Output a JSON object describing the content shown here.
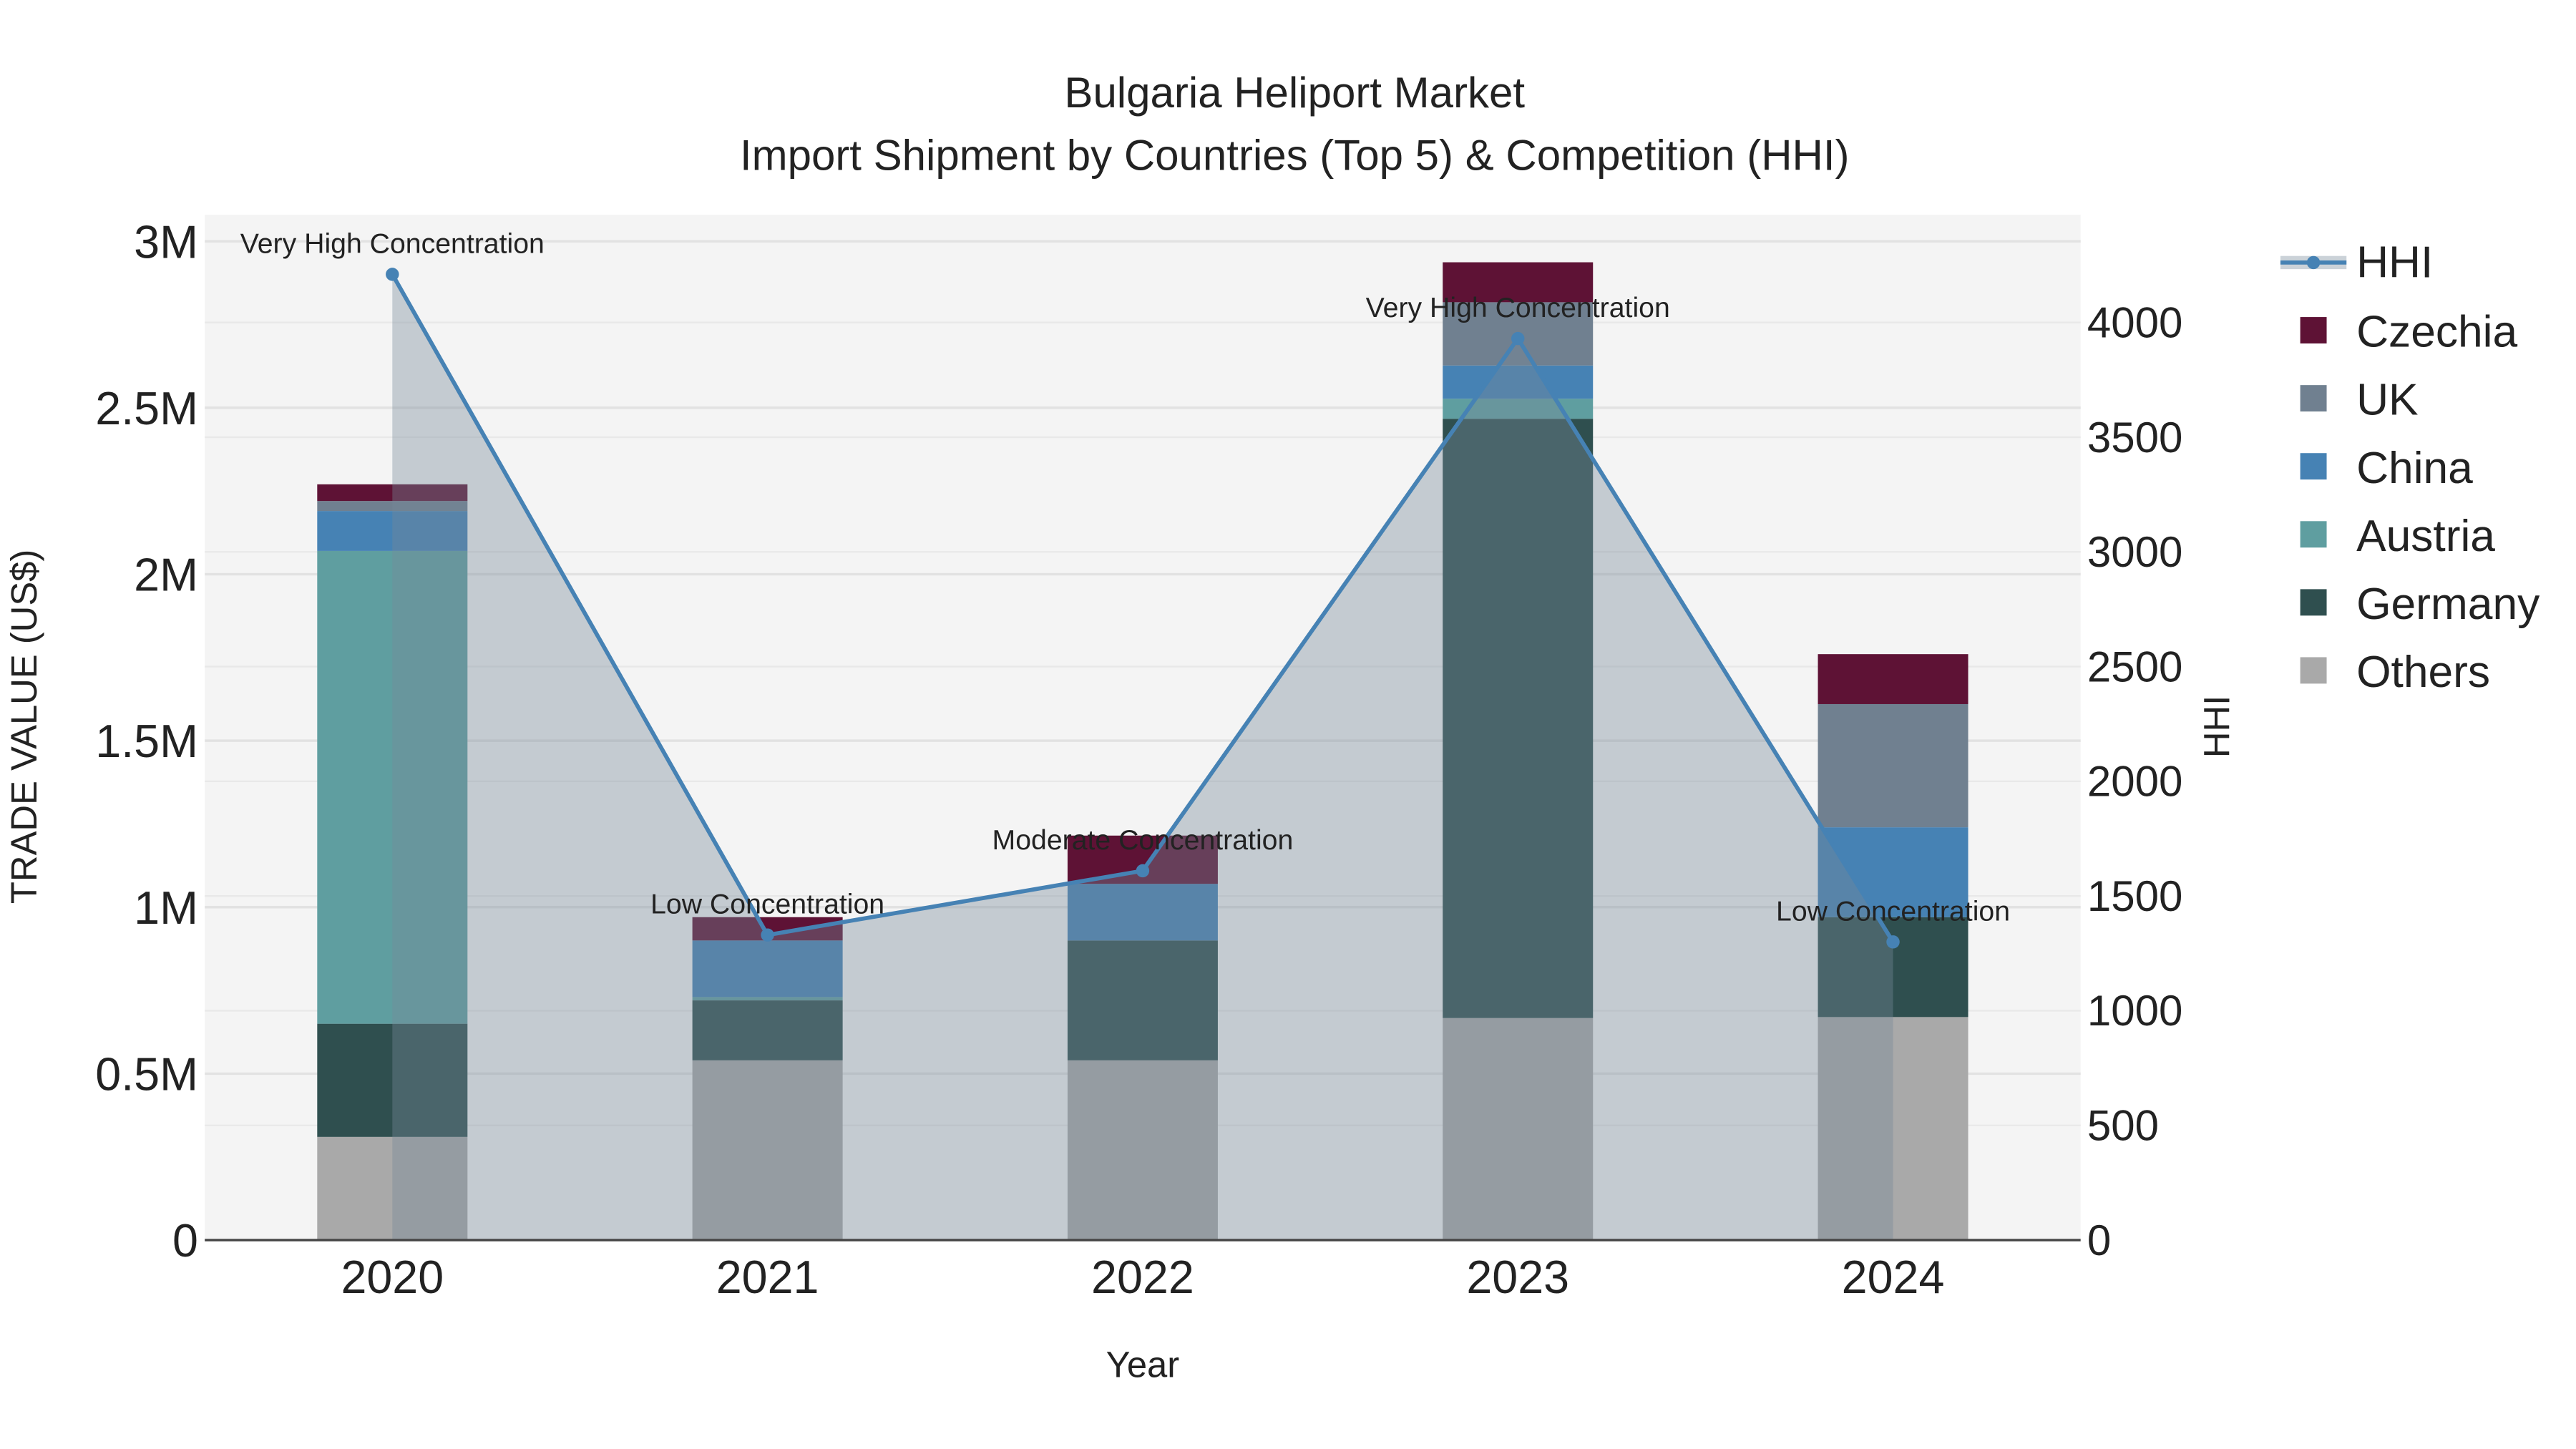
{
  "chart_data": {
    "type": "bar",
    "title": "Bulgaria Heliport Market",
    "subtitle": "Import Shipment by Countries (Top 5) & Competition (HHI)",
    "xlabel": "Year",
    "ylabel": "TRADE VALUE (US$)",
    "y2label": "HHI",
    "categories": [
      "2020",
      "2021",
      "2022",
      "2023",
      "2024"
    ],
    "ylim": [
      0,
      3.08
    ],
    "y2lim": [
      0,
      4470
    ],
    "yticks": [
      {
        "v": 0,
        "label": "0"
      },
      {
        "v": 0.5,
        "label": "0.5M"
      },
      {
        "v": 1,
        "label": "1M"
      },
      {
        "v": 1.5,
        "label": "1.5M"
      },
      {
        "v": 2,
        "label": "2M"
      },
      {
        "v": 2.5,
        "label": "2.5M"
      },
      {
        "v": 3,
        "label": "3M"
      }
    ],
    "y2ticks": [
      0,
      500,
      1000,
      1500,
      2000,
      2500,
      3000,
      3500,
      4000
    ],
    "units": "US$ millions",
    "series": [
      {
        "name": "Others",
        "color": "#a9a9a9",
        "values": [
          0.31,
          0.54,
          0.54,
          0.667,
          0.67
        ]
      },
      {
        "name": "Germany",
        "color": "#2f4f4f",
        "values": [
          0.34,
          0.18,
          0.36,
          1.8,
          0.3
        ]
      },
      {
        "name": "Austria",
        "color": "#5f9ea0",
        "values": [
          1.42,
          0.01,
          0.0,
          0.06,
          0.0
        ]
      },
      {
        "name": "China",
        "color": "#4682b4",
        "values": [
          0.12,
          0.17,
          0.17,
          0.1,
          0.27
        ]
      },
      {
        "name": "UK",
        "color": "#708090",
        "values": [
          0.03,
          0.0,
          0.0,
          0.19,
          0.37
        ]
      },
      {
        "name": "Czechia",
        "color": "#5e1235",
        "values": [
          0.05,
          0.07,
          0.145,
          0.12,
          0.15
        ]
      }
    ],
    "hhi": {
      "name": "HHI",
      "color": "#4682b4",
      "values": [
        4210,
        1330,
        1610,
        3930,
        1300
      ],
      "annotations": [
        "Very High Concentration",
        "Low Concentration",
        "Moderate Concentration",
        "Very High Concentration",
        "Low Concentration"
      ]
    },
    "legend": [
      "HHI",
      "Czechia",
      "UK",
      "China",
      "Austria",
      "Germany",
      "Others"
    ],
    "legend_position": "right",
    "grid": true
  }
}
